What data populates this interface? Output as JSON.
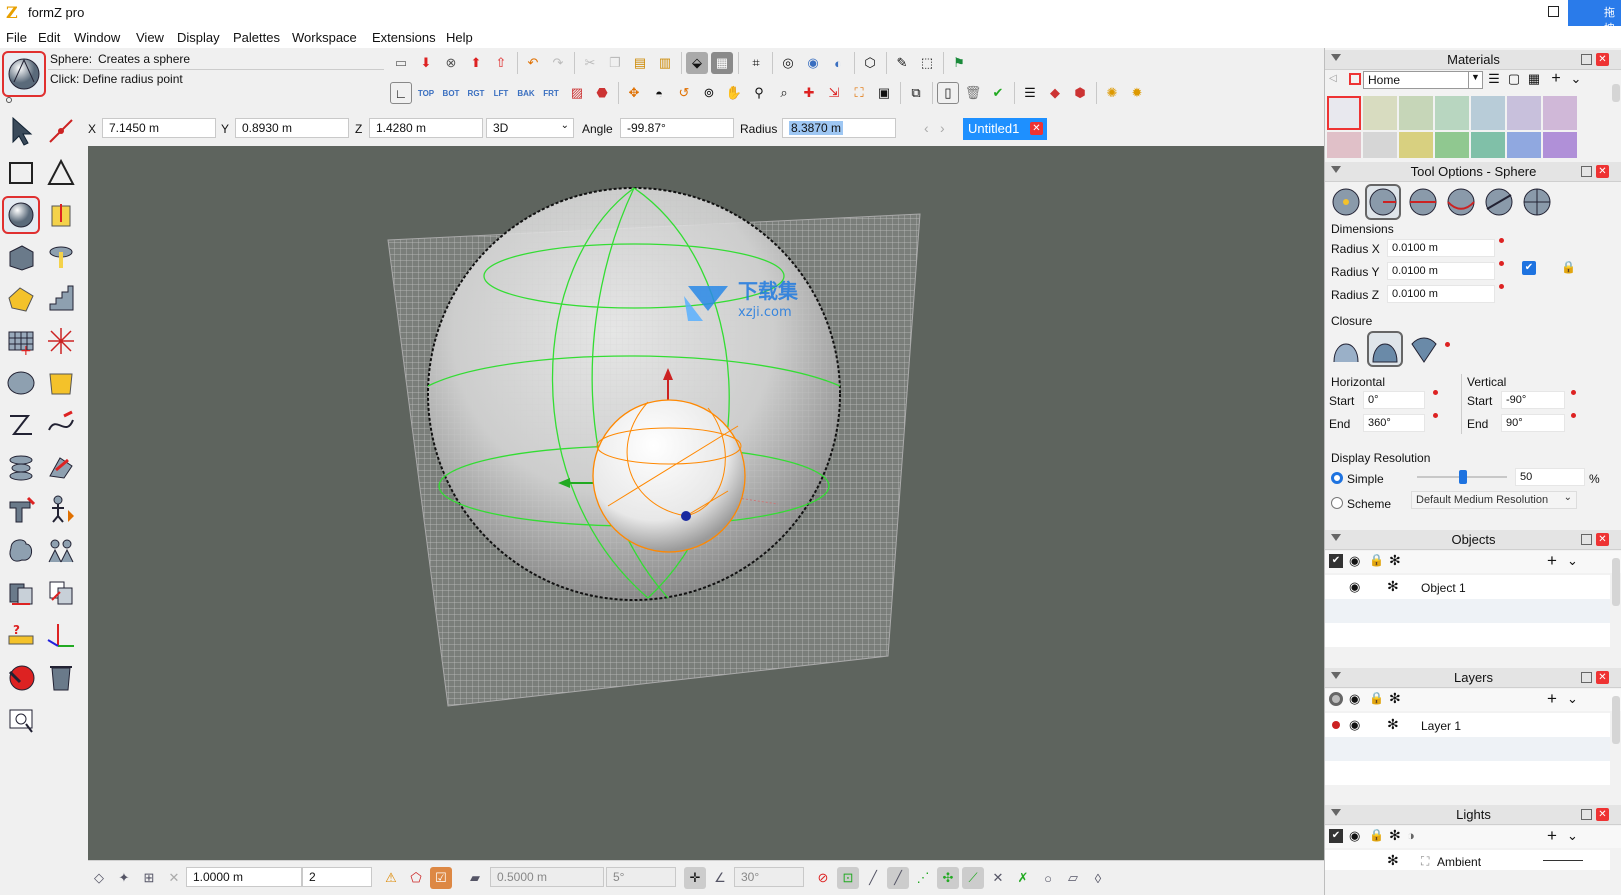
{
  "app": {
    "title": "formZ pro",
    "logo": "Z"
  },
  "cloud_label": "拖拽",
  "menu": [
    "File",
    "Edit",
    "Window",
    "View",
    "Display",
    "Palettes",
    "Workspace",
    "Extensions",
    "Help"
  ],
  "tool_info": {
    "name_label": "Sphere:",
    "description": "Creates a sphere",
    "hint": "Click: Define radius point"
  },
  "view_buttons": [
    "TOP",
    "BOT",
    "RGT",
    "LFT",
    "BAK",
    "FRT"
  ],
  "coords": {
    "x_label": "X",
    "x": "7.1450 m",
    "y_label": "Y",
    "y": "0.8930 m",
    "z_label": "Z",
    "z": "1.4280 m",
    "mode": "3D",
    "angle_label": "Angle",
    "angle": "-99.87°",
    "radius_label": "Radius",
    "radius": "8.3870 m"
  },
  "document_tab": "Untitled1",
  "bottom_bar": {
    "grid": "1.0000 m",
    "divisions": "2",
    "snap": "0.5000 m",
    "angle": "5°",
    "angle2": "30°"
  },
  "materials": {
    "title": "Materials",
    "library": "Home"
  },
  "tool_options": {
    "title": "Tool Options - Sphere",
    "dimensions_label": "Dimensions",
    "radius_x_label": "Radius X",
    "radius_x": "0.0100 m",
    "radius_y_label": "Radius Y",
    "radius_y": "0.0100 m",
    "radius_z_label": "Radius Z",
    "radius_z": "0.0100 m",
    "closure_label": "Closure",
    "horizontal_label": "Horizontal",
    "h_start_label": "Start",
    "h_start": "0°",
    "h_end_label": "End",
    "h_end": "360°",
    "vertical_label": "Vertical",
    "v_start_label": "Start",
    "v_start": "-90°",
    "v_end_label": "End",
    "v_end": "90°",
    "display_resolution_label": "Display Resolution",
    "simple_label": "Simple",
    "resolution_value": "50",
    "percent": "%",
    "scheme_label": "Scheme",
    "scheme_value": "Default Medium Resolution"
  },
  "objects": {
    "title": "Objects",
    "items": [
      "Object 1"
    ]
  },
  "layers": {
    "title": "Layers",
    "items": [
      "Layer 1"
    ]
  },
  "lights": {
    "title": "Lights",
    "items": [
      "Ambient"
    ]
  },
  "watermark": {
    "line1": "下载集",
    "line2": "xzji.com"
  },
  "colors": {
    "accent": "#1e73e0",
    "viewport": "#5e645e",
    "tab_blue": "#1e90ff",
    "red": "#e03030",
    "wire_green": "#33dd33",
    "wire_orange": "#ff8800"
  }
}
